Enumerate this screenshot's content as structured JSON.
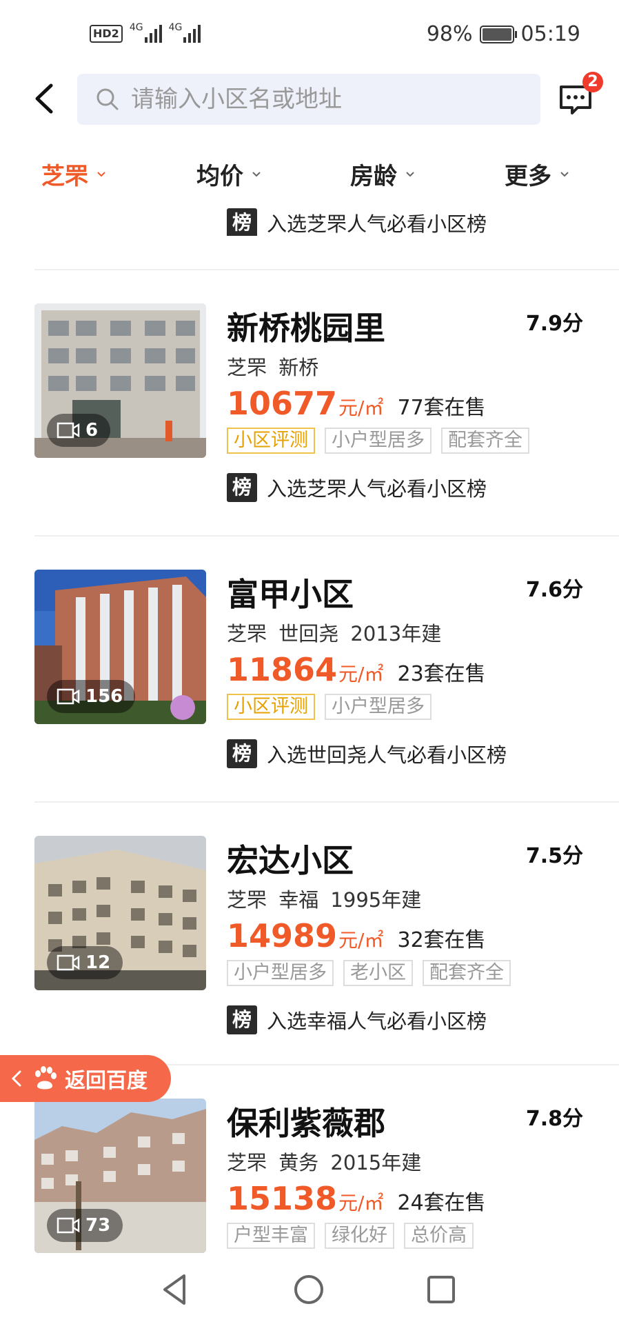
{
  "status_bar": {
    "net_hd": "HD",
    "net_2": "2",
    "sig1": "4G",
    "sig2": "4G",
    "battery": "98%",
    "time": "05:19"
  },
  "search": {
    "placeholder": "请输入小区名或地址"
  },
  "messages": {
    "badge": "2"
  },
  "filters": [
    {
      "label": "芝罘",
      "active": true
    },
    {
      "label": "均价",
      "active": false
    },
    {
      "label": "房龄",
      "active": false
    },
    {
      "label": "更多",
      "active": false
    }
  ],
  "partial_rank": {
    "badge": "榜",
    "text": "入选芝罘人气必看小区榜"
  },
  "listings": [
    {
      "name": "新桥桃园里",
      "score": "7.9分",
      "location": "芝罘 新桥",
      "price": "10677",
      "unit": "元/㎡",
      "on_sale": "77套在售",
      "video_count": "6",
      "tags": [
        "小区评测",
        "小户型居多",
        "配套齐全"
      ],
      "rank_badge": "榜",
      "rank_text": "入选芝罘人气必看小区榜"
    },
    {
      "name": "富甲小区",
      "score": "7.6分",
      "location": "芝罘 世回尧 2013年建",
      "price": "11864",
      "unit": "元/㎡",
      "on_sale": "23套在售",
      "video_count": "156",
      "tags": [
        "小区评测",
        "小户型居多"
      ],
      "rank_badge": "榜",
      "rank_text": "入选世回尧人气必看小区榜"
    },
    {
      "name": "宏达小区",
      "score": "7.5分",
      "location": "芝罘 幸福 1995年建",
      "price": "14989",
      "unit": "元/㎡",
      "on_sale": "32套在售",
      "video_count": "12",
      "tags": [
        "小户型居多",
        "老小区",
        "配套齐全"
      ],
      "rank_badge": "榜",
      "rank_text": "入选幸福人气必看小区榜"
    },
    {
      "name": "保利紫薇郡",
      "score": "7.8分",
      "location": "芝罘 黄务 2015年建",
      "price": "15138",
      "unit": "元/㎡",
      "on_sale": "24套在售",
      "video_count": "73",
      "tags": [
        "户型丰富",
        "绿化好",
        "总价高"
      ]
    }
  ],
  "return_button": {
    "label": "返回百度"
  },
  "colors": {
    "accent": "#f05a28",
    "review_tag": "#e6a100",
    "return_bg": "#f5694a"
  }
}
